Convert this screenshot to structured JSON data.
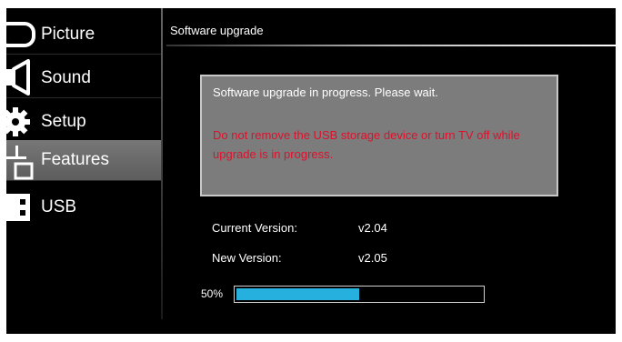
{
  "sidebar": {
    "items": [
      {
        "label": "Picture",
        "icon": "picture-icon",
        "selected": false
      },
      {
        "label": "Sound",
        "icon": "sound-icon",
        "selected": false
      },
      {
        "label": "Setup",
        "icon": "setup-gear-icon",
        "selected": false
      },
      {
        "label": "Features",
        "icon": "features-icon",
        "selected": true
      },
      {
        "label": "USB",
        "icon": "usb-icon",
        "selected": false
      }
    ]
  },
  "header": {
    "title": "Software upgrade"
  },
  "message": {
    "status": "Software upgrade in progress. Please wait.",
    "warning": "Do not remove the USB storage device or turn TV off while upgrade is in progress."
  },
  "versions": {
    "current_label": "Current Version:",
    "current_value": "v2.04",
    "new_label": "New Version:",
    "new_value": "v2.05"
  },
  "progress": {
    "label": "50%",
    "value": 0.5
  },
  "colors": {
    "warning": "#e0102b",
    "progress_fill": "#26b0de",
    "message_box": "#7c7c7c",
    "selected_item": "#6b6b6b"
  }
}
